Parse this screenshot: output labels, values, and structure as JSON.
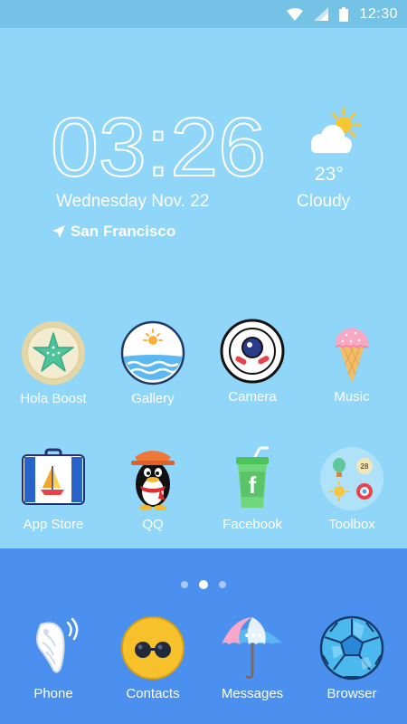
{
  "status_bar": {
    "time": "12:30",
    "icons": [
      "wifi-icon",
      "signal-icon",
      "battery-icon"
    ]
  },
  "clock": {
    "time": "03:26",
    "date": "Wednesday Nov. 22",
    "location": "San Francisco"
  },
  "weather": {
    "temperature": "23°",
    "condition": "Cloudy",
    "icon": "partly-cloudy-icon"
  },
  "apps_row1": [
    {
      "label": "Hola Boost",
      "icon": "starfish-icon"
    },
    {
      "label": "Gallery",
      "icon": "sun-over-sea-icon"
    },
    {
      "label": "Camera",
      "icon": "camera-lens-icon"
    },
    {
      "label": "Music",
      "icon": "ice-cream-icon"
    }
  ],
  "apps_row2": [
    {
      "label": "App Store",
      "icon": "suitcase-icon"
    },
    {
      "label": "QQ",
      "icon": "penguin-icon"
    },
    {
      "label": "Facebook",
      "icon": "drink-cup-icon"
    },
    {
      "label": "Toolbox",
      "icon": "toolbox-grid-icon"
    }
  ],
  "page_indicator": {
    "pages": 3,
    "active": 2
  },
  "dock": [
    {
      "label": "Phone",
      "icon": "seashell-icon"
    },
    {
      "label": "Contacts",
      "icon": "sunglasses-face-icon"
    },
    {
      "label": "Messages",
      "icon": "umbrella-icon"
    },
    {
      "label": "Browser",
      "icon": "soccer-ball-icon"
    }
  ],
  "colors": {
    "sky": "#8fd6f8",
    "status_bar": "#74c3e6",
    "dock": "#4b90ee"
  }
}
